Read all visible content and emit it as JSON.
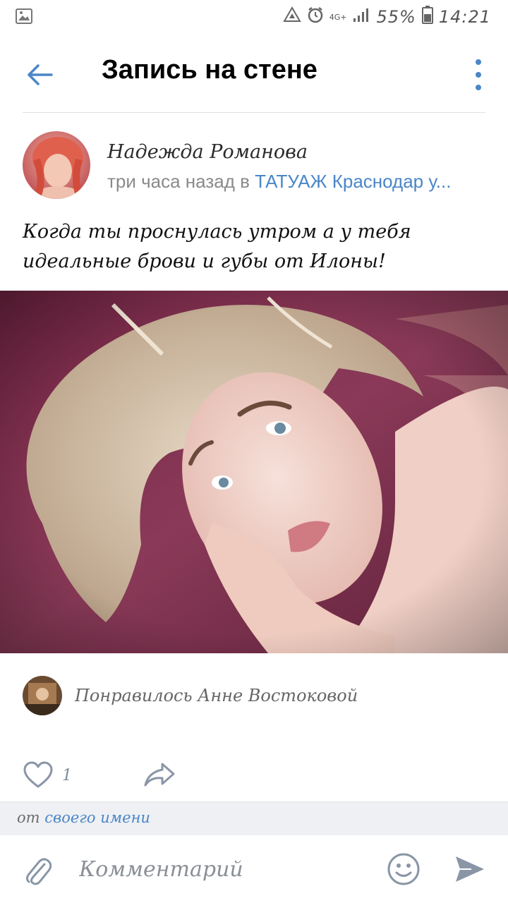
{
  "status_bar": {
    "network": "4G+",
    "battery": "55%",
    "time": "14:21"
  },
  "header": {
    "title": "Запись на стене"
  },
  "post": {
    "author_name": "Надежда Романова",
    "time_prefix": "три часа назад в ",
    "group_name": "ТАТУАЖ Краснодар у...",
    "text": "Когда ты проснулась утром а у тебя идеальные брови и губы от Илоны!"
  },
  "likes": {
    "text": "Понравилось Анне Востоковой"
  },
  "actions": {
    "like_count": "1"
  },
  "from_bar": {
    "prefix": "от ",
    "identity": "своего имени"
  },
  "composer": {
    "placeholder": "Комментарий"
  },
  "colors": {
    "accent": "#4a86c8",
    "icon_gray": "#8a96a6"
  }
}
